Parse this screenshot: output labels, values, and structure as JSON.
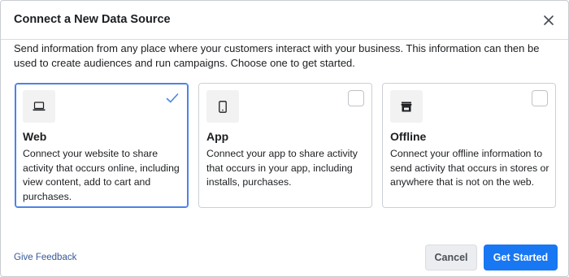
{
  "dialog": {
    "title": "Connect a New Data Source",
    "description": "Send information from any place where your customers interact with your business. This information can then be used to create audiences and run campaigns. Choose one to get started."
  },
  "cards": [
    {
      "title": "Web",
      "description": "Connect your website to share activity that occurs online, including view content, add to cart and purchases.",
      "icon": "laptop-icon",
      "selected": true
    },
    {
      "title": "App",
      "description": "Connect your app to share activity that occurs in your app, including installs, purchases.",
      "icon": "phone-icon",
      "selected": false
    },
    {
      "title": "Offline",
      "description": "Connect your offline information to send activity that occurs in stores or anywhere that is not on the web.",
      "icon": "store-icon",
      "selected": false
    }
  ],
  "footer": {
    "feedback_label": "Give Feedback",
    "cancel_label": "Cancel",
    "start_label": "Get Started"
  },
  "colors": {
    "accent": "#1877f2",
    "selected_border": "#4b83e6",
    "link": "#385898"
  }
}
